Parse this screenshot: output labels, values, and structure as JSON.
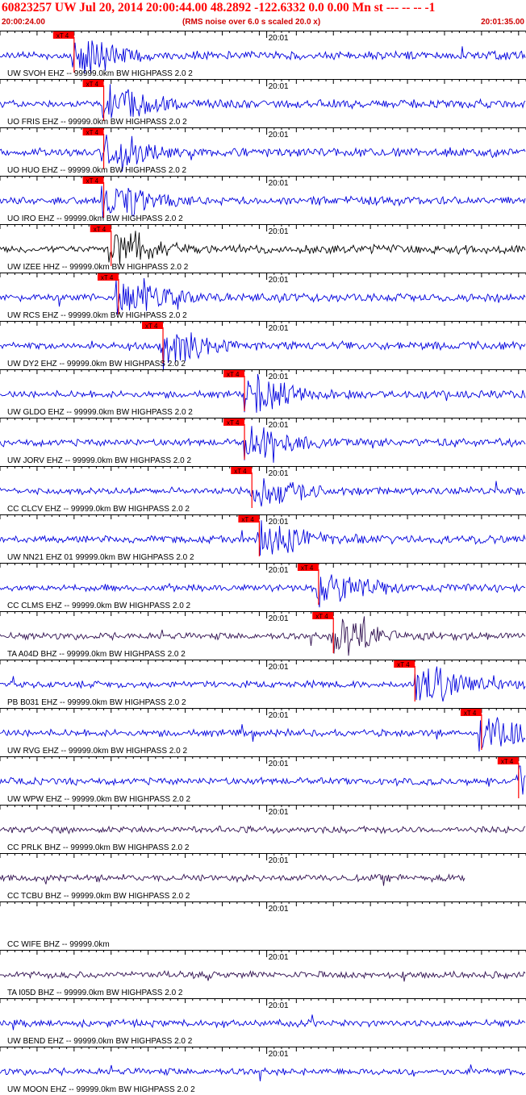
{
  "header": {
    "title": "60823257 UW Jul 20, 2014 20:00:44.00   48.2892 -122.6332  0.0 0.00 Mn st --- -- --  -1",
    "start_time": "20:00:24.00",
    "rms_note": "(RMS noise over 6.0 s scaled 20.0 x)",
    "end_time": "20:01:35.00"
  },
  "colors": {
    "trace": "#0000dd",
    "trace_dark": "#000000",
    "trace_purple": "#301050",
    "pick": "#ff0000",
    "axis": "#000000"
  },
  "chart_data": {
    "type": "line",
    "x_unit": "time (UTC)",
    "time_range": [
      "20:00:24.00",
      "20:01:35.00"
    ],
    "minute_marker_label": "20:01",
    "pick_label": "xT 4",
    "channels": [
      {
        "label": "UW SVOH EHZ -- 99999.0km BW  HIGHPASS  2.0  2",
        "color": "#0000dd",
        "pick": "20:00:34"
      },
      {
        "label": "UO FRIS EHZ -- 99999.0km BW  HIGHPASS  2.0  2",
        "color": "#0000dd",
        "pick": "20:00:38"
      },
      {
        "label": "UO HUO EHZ -- 99999.0km BW  HIGHPASS  2.0  2",
        "color": "#0000dd",
        "pick": "20:00:38"
      },
      {
        "label": "UO IRO EHZ -- 99999.0km BW  HIGHPASS  2.0  2",
        "color": "#0000dd",
        "pick": "20:00:38"
      },
      {
        "label": "UW IZEE HHZ -- 99999.0km BW  HIGHPASS  2.0  2",
        "color": "#000000",
        "pick": "20:00:39"
      },
      {
        "label": "UW RCS EHZ -- 99999.0km BW  HIGHPASS  2.0  2",
        "color": "#0000dd",
        "pick": "20:00:40"
      },
      {
        "label": "UW DY2 EHZ -- 99999.0km BW  HIGHPASS  2.0  2",
        "color": "#0000dd",
        "pick": "20:00:46"
      },
      {
        "label": "UW GLDO EHZ -- 99999.0km BW  HIGHPASS  2.0  2",
        "color": "#0000dd",
        "pick": "20:00:57"
      },
      {
        "label": "UW JORV EHZ -- 99999.0km BW  HIGHPASS  2.0  2",
        "color": "#0000dd",
        "pick": "20:00:57"
      },
      {
        "label": "CC CLCV EHZ -- 99999.0km BW  HIGHPASS  2.0  2",
        "color": "#0000dd",
        "pick": "20:00:58"
      },
      {
        "label": "UW NN21 EHZ 01 99999.0km BW  HIGHPASS  2.0  2",
        "color": "#0000dd",
        "pick": "20:00:59"
      },
      {
        "label": "CC CLMS EHZ -- 99999.0km BW  HIGHPASS  2.0  2",
        "color": "#0000dd",
        "pick": "20:01:07"
      },
      {
        "label": "TA A04D BHZ -- 99999.0km BW  HIGHPASS  2.0  2",
        "color": "#301050",
        "pick": "20:01:09"
      },
      {
        "label": "PB B031 EHZ -- 99999.0km BW  HIGHPASS  2.0  2",
        "color": "#0000dd",
        "pick": "20:01:20"
      },
      {
        "label": "UW RVG EHZ -- 99999.0km BW  HIGHPASS  2.0  2",
        "color": "#0000dd",
        "pick": "20:01:29"
      },
      {
        "label": "UW WPW EHZ -- 99999.0km BW  HIGHPASS  2.0  2",
        "color": "#0000dd",
        "pick": "20:01:34"
      },
      {
        "label": "CC PRLK BHZ -- 99999.0km BW  HIGHPASS  2.0  2",
        "color": "#301050",
        "pick": null
      },
      {
        "label": "CC TCBU BHZ -- 99999.0km BW  HIGHPASS  2.0  2",
        "color": "#301050",
        "pick": null
      },
      {
        "label": "CC WIFE BHZ -- 99999.0km",
        "color": "#0000dd",
        "pick": null
      },
      {
        "label": "TA I05D BHZ -- 99999.0km BW  HIGHPASS  2.0  2",
        "color": "#301050",
        "pick": null
      },
      {
        "label": "UW BEND EHZ -- 99999.0km BW  HIGHPASS  2.0  2",
        "color": "#0000dd",
        "pick": null
      },
      {
        "label": "UW MOON EHZ -- 99999.0km BW  HIGHPASS  2.0  2",
        "color": "#0000dd",
        "pick": null
      }
    ]
  }
}
